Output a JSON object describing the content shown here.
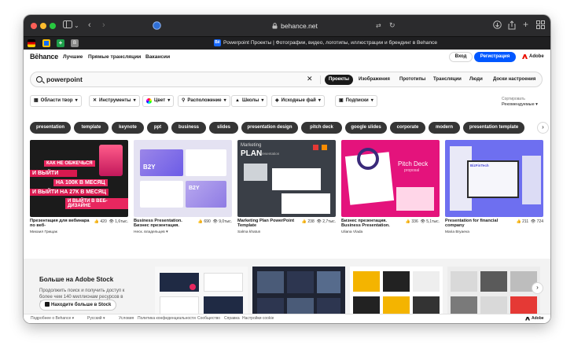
{
  "browser": {
    "url": "behance.net",
    "tab_title": "Powerpoint Проекты | Фотографии, видео, логотипы, иллюстрации и брендинг в Behance",
    "tab_icon": "Bē"
  },
  "nav": {
    "logo": "Bēhance",
    "links": [
      "Лучшие",
      "Прямые трансляции",
      "Вакансии"
    ],
    "login": "Вход",
    "register": "Регистрация",
    "adobe": "Adobe"
  },
  "search": {
    "query": "powerpoint",
    "tabs": [
      "Проекты",
      "Изображения",
      "Прототипы",
      "Трансляции",
      "Люди",
      "Доски настроения"
    ]
  },
  "filters": {
    "items": [
      "Области твор",
      "Инструменты",
      "Цвет",
      "Расположение",
      "Школы",
      "Исходные фай",
      "Подписки"
    ],
    "sort_label": "Сортировать",
    "sort_value": "Рекомендуемые"
  },
  "tags": [
    "presentation",
    "template",
    "keynote",
    "ppt",
    "business",
    "slides",
    "presentation design",
    "pitch deck",
    "google slides",
    "corporate",
    "modern",
    "presentation template"
  ],
  "cards": [
    {
      "title": "Презентация для вебинара по веб-",
      "author": "Михаил Грищак",
      "likes": "420",
      "views": "1,6тыс.",
      "img": {
        "line1": "КАК НЕ ОБЖЕЧЬСЯ",
        "line2": "И ВЫЙТИ",
        "line3": "НА 100К В МЕСЯЦ",
        "line4": "И ВЫЙТИ НА 27К В МЕСЯЦ",
        "line5": "И ВЫЙТИ В ВЕБ-ДИЗАЙНЕ"
      }
    },
    {
      "title": "Business Presentation. Бизнес презентация.",
      "author": "Неск. владельцев",
      "likes": "690",
      "views": "9,0тыс.",
      "img": {
        "line1": "B2Y",
        "line2": "B2Y"
      }
    },
    {
      "title": "Marketing Plan PowerPoint Template",
      "author": "Salma khatun",
      "likes": "238",
      "views": "2,7тыс.",
      "img": {
        "line1": "Marketing",
        "line2": "PLAN",
        "line3": "Presentation"
      }
    },
    {
      "title": "Бизнес презентация. Business Presentation.",
      "author": "Uliana Vlada",
      "likes": "336",
      "views": "5,1тыс.",
      "img": {
        "line1": "Pitch Deck",
        "line2": "proposal"
      }
    },
    {
      "title": "Presentation for financial company",
      "author": "Maria Bryaeva",
      "likes": "211",
      "views": "724",
      "img": {
        "line1": "BizFinTech"
      }
    }
  ],
  "stock": {
    "title": "Больше на Adobe Stock",
    "desc": "Продолжить поиск и получить доступ к более чем 140 миллионам ресурсов в Adobe Stock",
    "button": "Находите больше в Stock"
  },
  "footer": {
    "links": [
      "Подробнее о Behance",
      "Русский",
      "Условия",
      "Политика конфиденциальности",
      "Сообщество",
      "Справка",
      "Настройки cookie"
    ],
    "adobe": "Adobe"
  },
  "colors": {
    "accent": "#0057ff",
    "adobe_red": "#eb1000",
    "tag_bg": "#353535"
  }
}
